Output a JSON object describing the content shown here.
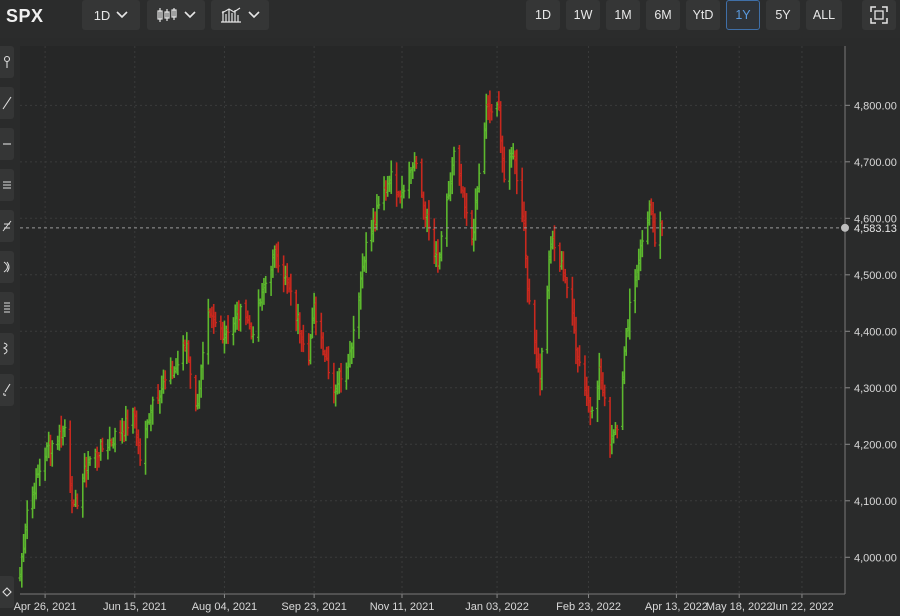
{
  "symbol": "SPX",
  "toolbar": {
    "interval_label": "1D",
    "chart_type_icon": "candlestick-icon",
    "indicators_icon": "bar-chart-icon",
    "ranges": [
      "1D",
      "1W",
      "1M",
      "6M",
      "YtD",
      "1Y",
      "5Y",
      "ALL"
    ],
    "selected_range": "1Y",
    "fullscreen_icon": "fullscreen-icon"
  },
  "drawing_tools": [
    "pin-icon",
    "line-icon",
    "horizontal-line-icon",
    "channel-icon",
    "fib-icon",
    "arc-icon",
    "path-icon",
    "pitchfork-icon",
    "brush-icon",
    "eraser-icon"
  ],
  "colors": {
    "up": "#5cb82e",
    "down": "#c8281e",
    "crosshair": "#9a9a9a",
    "grid": "#3a3b3b",
    "accent": "#3f6fa8"
  },
  "chart_data": {
    "type": "ohlc",
    "title": "",
    "xlabel": "",
    "ylabel": "",
    "y_tick_labels": [
      "4,000.00",
      "4,100.00",
      "4,200.00",
      "4,300.00",
      "4,400.00",
      "4,500.00",
      "4,600.00",
      "4,700.00",
      "4,800.00"
    ],
    "y_ticks": [
      4000,
      4100,
      4200,
      4300,
      4400,
      4500,
      4600,
      4700,
      4800
    ],
    "ylim": [
      3935,
      4905
    ],
    "x_tick_labels": [
      "Apr 26, 2021",
      "Jun 15, 2021",
      "Aug 04, 2021",
      "Sep 23, 2021",
      "Nov 11, 2021",
      "Jan 03, 2022",
      "Feb 23, 2022",
      "Apr 13, 2022",
      "May 18, 2022",
      "Jun 22, 2022"
    ],
    "x_tick_dates": [
      "2021-04-26",
      "2021-06-15",
      "2021-08-04",
      "2021-09-23",
      "2021-11-11",
      "2022-01-03",
      "2022-02-23",
      "2022-04-13",
      "2022-05-18",
      "2022-06-22"
    ],
    "xlim": [
      "2021-04-12",
      "2022-07-16"
    ],
    "last_price": 4583.13,
    "last_price_label": "4,583.13",
    "grid": true,
    "anchors": [
      [
        "2021-04-12",
        3970
      ],
      [
        "2021-04-16",
        4085
      ],
      [
        "2021-04-26",
        4185
      ],
      [
        "2021-05-07",
        4230
      ],
      [
        "2021-05-12",
        4080
      ],
      [
        "2021-05-20",
        4170
      ],
      [
        "2021-06-01",
        4205
      ],
      [
        "2021-06-15",
        4250
      ],
      [
        "2021-06-18",
        4175
      ],
      [
        "2021-06-25",
        4280
      ],
      [
        "2021-07-08",
        4335
      ],
      [
        "2021-07-14",
        4380
      ],
      [
        "2021-07-19",
        4260
      ],
      [
        "2021-07-26",
        4420
      ],
      [
        "2021-08-04",
        4400
      ],
      [
        "2021-08-16",
        4440
      ],
      [
        "2021-08-19",
        4395
      ],
      [
        "2021-08-30",
        4520
      ],
      [
        "2021-09-02",
        4540
      ],
      [
        "2021-09-10",
        4460
      ],
      [
        "2021-09-20",
        4360
      ],
      [
        "2021-09-23",
        4440
      ],
      [
        "2021-10-01",
        4340
      ],
      [
        "2021-10-04",
        4300
      ],
      [
        "2021-10-13",
        4360
      ],
      [
        "2021-10-21",
        4540
      ],
      [
        "2021-11-04",
        4675
      ],
      [
        "2021-11-10",
        4650
      ],
      [
        "2021-11-18",
        4700
      ],
      [
        "2021-11-26",
        4580
      ],
      [
        "2021-12-01",
        4510
      ],
      [
        "2021-12-10",
        4710
      ],
      [
        "2021-12-17",
        4600
      ],
      [
        "2021-12-20",
        4560
      ],
      [
        "2021-12-28",
        4790
      ],
      [
        "2022-01-04",
        4790
      ],
      [
        "2022-01-07",
        4670
      ],
      [
        "2022-01-12",
        4720
      ],
      [
        "2022-01-18",
        4590
      ],
      [
        "2022-01-21",
        4440
      ],
      [
        "2022-01-27",
        4320
      ],
      [
        "2022-02-02",
        4560
      ],
      [
        "2022-02-10",
        4500
      ],
      [
        "2022-02-14",
        4420
      ],
      [
        "2022-02-17",
        4360
      ],
      [
        "2022-02-24",
        4260
      ],
      [
        "2022-03-01",
        4330
      ],
      [
        "2022-03-07",
        4210
      ],
      [
        "2022-03-11",
        4240
      ],
      [
        "2022-03-18",
        4450
      ],
      [
        "2022-03-25",
        4560
      ],
      [
        "2022-03-29",
        4620
      ],
      [
        "2022-04-01",
        4560
      ],
      [
        "2022-04-05",
        4583
      ]
    ]
  }
}
